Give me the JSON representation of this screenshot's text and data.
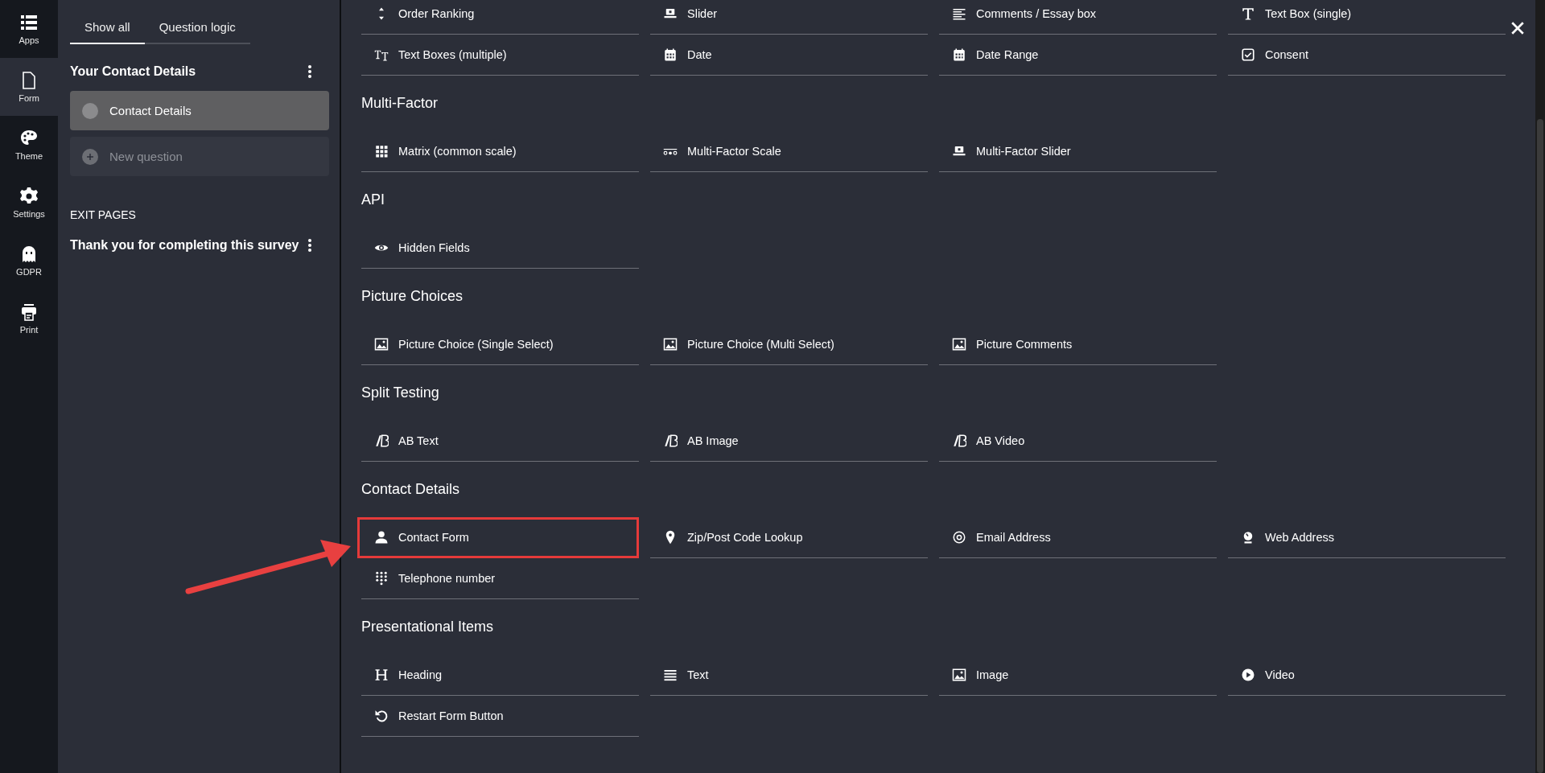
{
  "rail": [
    {
      "label": "Apps",
      "kind": "apps",
      "selected": false
    },
    {
      "label": "Form",
      "kind": "form",
      "selected": true
    },
    {
      "label": "Theme",
      "kind": "theme",
      "selected": false
    },
    {
      "label": "Settings",
      "kind": "settings",
      "selected": false
    },
    {
      "label": "GDPR",
      "kind": "gdpr",
      "selected": false
    },
    {
      "label": "Print",
      "kind": "print",
      "selected": false
    }
  ],
  "tabs": [
    {
      "label": "Show all",
      "selected": true
    },
    {
      "label": "Question logic",
      "selected": false
    }
  ],
  "page": {
    "title": "Your Contact Details",
    "questions": [
      {
        "label": "Contact Details",
        "kind": "question",
        "selected": true
      },
      {
        "label": "New question",
        "kind": "add",
        "selected": false
      }
    ]
  },
  "exit_pages": {
    "label": "EXIT PAGES",
    "items": [
      {
        "label": "Thank you for completing this survey"
      }
    ]
  },
  "sections": [
    {
      "items": [
        {
          "label": "Order Ranking",
          "kind": "ranking"
        },
        {
          "label": "Slider",
          "kind": "slider"
        },
        {
          "label": "Comments / Essay box",
          "kind": "essay"
        },
        {
          "label": "Text Box (single)",
          "kind": "text-single"
        },
        {
          "label": "Text Boxes (multiple)",
          "kind": "text-multi"
        },
        {
          "label": "Date",
          "kind": "date"
        },
        {
          "label": "Date Range",
          "kind": "date"
        },
        {
          "label": "Consent",
          "kind": "consent"
        }
      ]
    },
    {
      "title": "Multi-Factor",
      "items": [
        {
          "label": "Matrix (common scale)",
          "kind": "matrix"
        },
        {
          "label": "Multi-Factor Scale",
          "kind": "mf-scale"
        },
        {
          "label": "Multi-Factor Slider",
          "kind": "slider"
        }
      ]
    },
    {
      "title": "API",
      "items": [
        {
          "label": "Hidden Fields",
          "kind": "hidden"
        }
      ]
    },
    {
      "title": "Picture Choices",
      "items": [
        {
          "label": "Picture Choice (Single Select)",
          "kind": "picture"
        },
        {
          "label": "Picture Choice (Multi Select)",
          "kind": "picture"
        },
        {
          "label": "Picture Comments",
          "kind": "picture"
        }
      ]
    },
    {
      "title": "Split Testing",
      "items": [
        {
          "label": "AB Text",
          "kind": "ab"
        },
        {
          "label": "AB Image",
          "kind": "ab"
        },
        {
          "label": "AB Video",
          "kind": "ab"
        }
      ]
    },
    {
      "title": "Contact Details",
      "items": [
        {
          "label": "Contact Form",
          "kind": "person",
          "highlighted": true
        },
        {
          "label": "Zip/Post Code Lookup",
          "kind": "pin",
          "highlighted": false
        },
        {
          "label": "Email Address",
          "kind": "email",
          "highlighted": false
        },
        {
          "label": "Web Address",
          "kind": "web",
          "highlighted": false
        },
        {
          "label": "Telephone number",
          "kind": "dialpad",
          "highlighted": false
        }
      ]
    },
    {
      "title": "Presentational Items",
      "items": [
        {
          "label": "Heading",
          "kind": "heading"
        },
        {
          "label": "Text",
          "kind": "lines"
        },
        {
          "label": "Image",
          "kind": "picture"
        },
        {
          "label": "Video",
          "kind": "video"
        },
        {
          "label": "Restart Form Button",
          "kind": "restart"
        }
      ]
    }
  ]
}
